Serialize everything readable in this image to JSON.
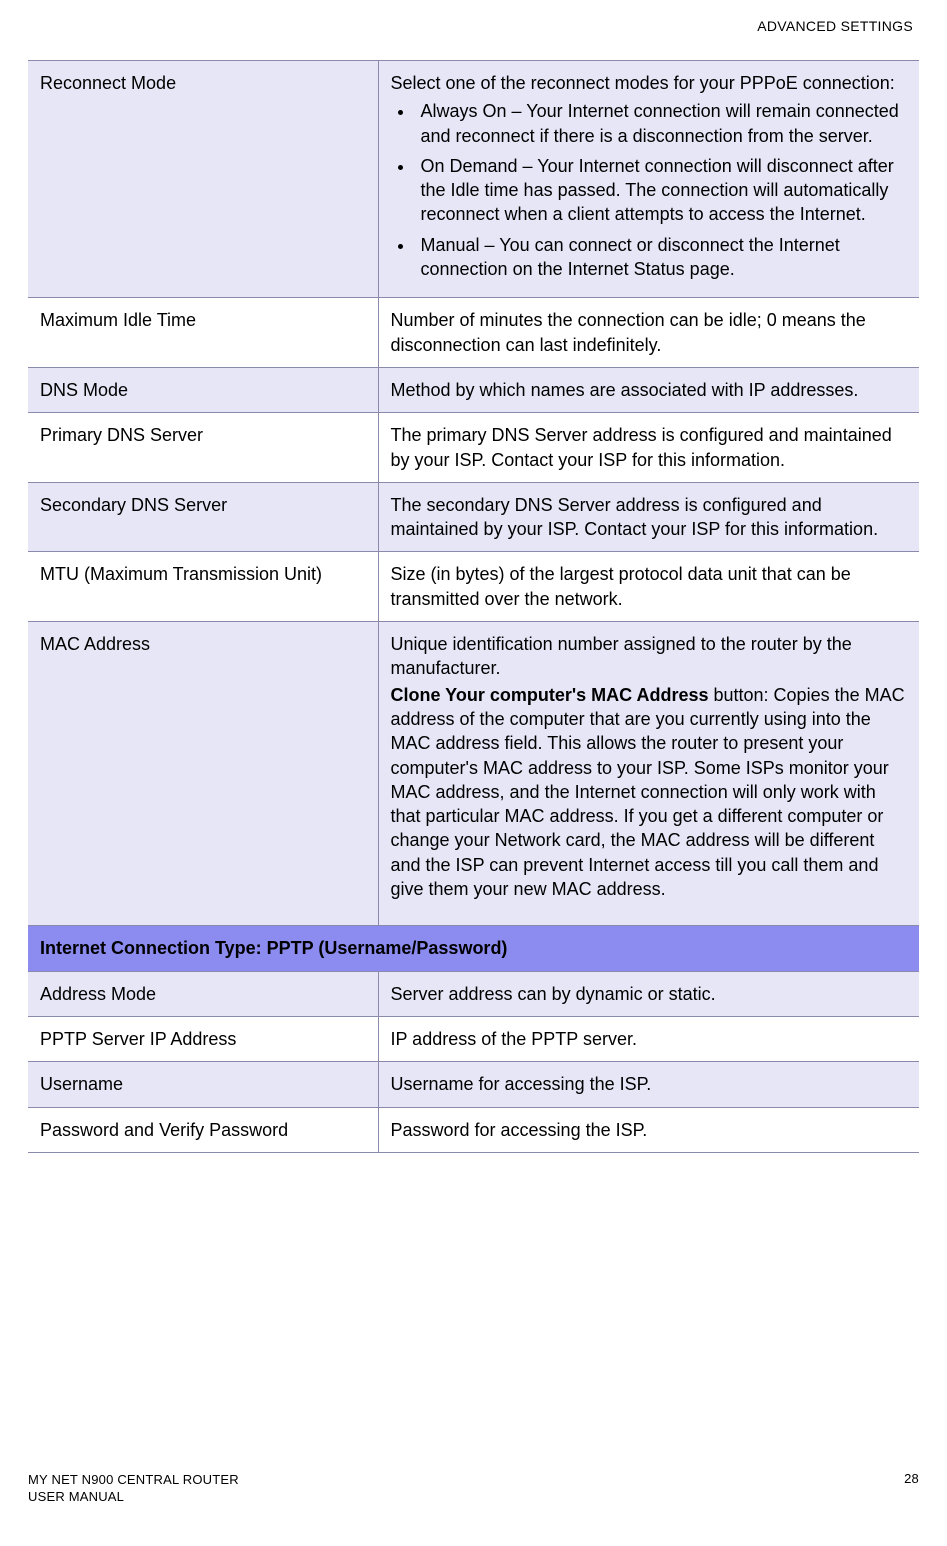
{
  "header": {
    "section": "ADVANCED SETTINGS"
  },
  "rows": {
    "r0": {
      "label": "Reconnect Mode",
      "intro": "Select one of the reconnect modes for your PPPoE connection:",
      "b1": "Always On – Your Internet connection will remain connected and reconnect if there is a disconnection from the server.",
      "b2": "On Demand – Your Internet connection will disconnect after the Idle time has passed. The connection will automatically reconnect when a client attempts to access the Internet.",
      "b3": "Manual – You can connect or disconnect the Internet connection on the Internet Status page."
    },
    "r1": {
      "label": "Maximum Idle Time",
      "desc": "Number of minutes the connection can be idle; 0 means the disconnection can last indefinitely."
    },
    "r2": {
      "label": "DNS Mode",
      "desc": "Method by which names are associated with IP addresses."
    },
    "r3": {
      "label": "Primary DNS Server",
      "desc": "The primary DNS Server address is configured and maintained by your ISP. Contact your ISP for this information."
    },
    "r4": {
      "label": "Secondary DNS Server",
      "desc": "The secondary DNS Server address is configured and maintained by your ISP. Contact your ISP for this information."
    },
    "r5": {
      "label": "MTU (Maximum Transmission Unit)",
      "desc": "Size (in bytes) of the largest protocol data unit that can be transmitted over the network."
    },
    "r6": {
      "label": "MAC Address",
      "d1": "Unique identification number assigned to the router by the manufacturer.",
      "d2a": "Clone Your computer's MAC Address",
      "d2b": " button: Copies the MAC address of the computer that are you currently using into the MAC address field. This allows the router to present your computer's MAC address to your ISP. Some ISPs monitor your MAC address, and the Internet connection will only work with that particular MAC address. If you get a different computer or change your Network card, the MAC address will be different and the ISP can prevent Internet access till you call them and give them your new MAC address."
    },
    "section": "Internet Connection Type: PPTP (Username/Password)",
    "r7": {
      "label": "Address Mode",
      "desc": "Server address can by dynamic or static."
    },
    "r8": {
      "label": "PPTP Server IP Address",
      "desc": "IP address of the PPTP server."
    },
    "r9": {
      "label": "Username",
      "desc": "Username for accessing the ISP."
    },
    "r10": {
      "label": "Password and Verify Password",
      "desc": "Password for accessing the ISP."
    }
  },
  "footer": {
    "line1": "MY NET N900 CENTRAL ROUTER",
    "line2": "USER MANUAL",
    "page": "28"
  }
}
